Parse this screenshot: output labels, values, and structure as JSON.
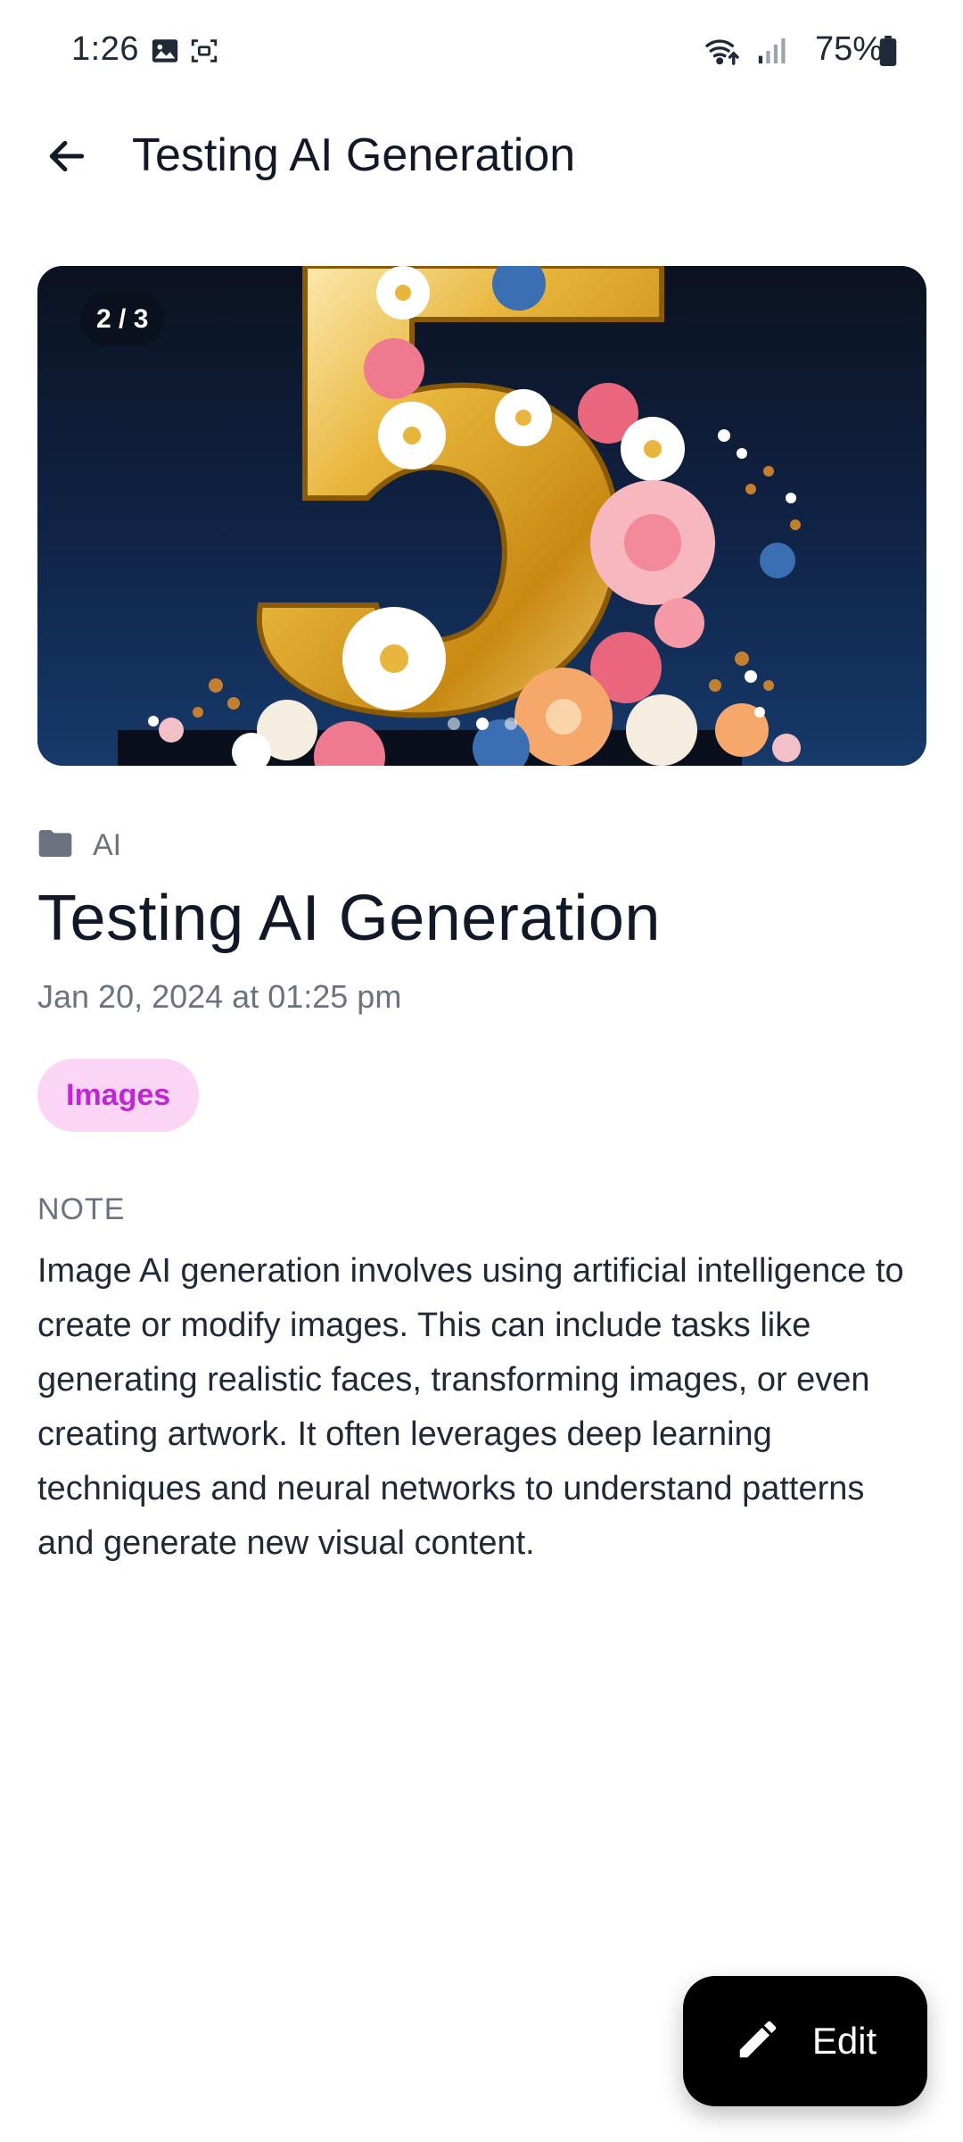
{
  "status_bar": {
    "time": "1:26",
    "battery": "75%",
    "icons": [
      "image-icon",
      "screenshot-icon",
      "wifi-icon",
      "signal-icon",
      "battery-icon"
    ]
  },
  "app_bar": {
    "title": "Testing AI Generation",
    "back_icon": "arrow-left-icon"
  },
  "hero": {
    "counter": "2 / 3",
    "current_index": 2,
    "total": 3
  },
  "content": {
    "category_icon": "folder-icon",
    "category": "AI",
    "title": "Testing AI Generation",
    "date": "Jan 20, 2024 at 01:25 pm",
    "tag": "Images",
    "note_label": "NOTE",
    "note_text": "Image AI generation involves using artificial intelligence to create or modify images. This can include tasks like generating realistic faces, transforming images, or even creating artwork. It often leverages deep learning techniques and neural networks to understand patterns and generate new visual content."
  },
  "fab": {
    "label": "Edit",
    "icon": "pencil-icon"
  },
  "colors": {
    "tag_bg": "#fad5f6",
    "tag_text": "#c026d3",
    "fab_bg": "#000000",
    "muted_text": "#6b7280"
  }
}
